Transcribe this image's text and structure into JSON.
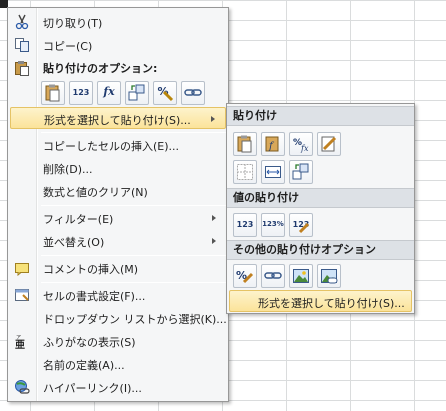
{
  "main_menu": {
    "cut": "切り取り(T)",
    "copy": "コピー(C)",
    "paste_options_header": "貼り付けのオプション:",
    "paste_special": "形式を選択して貼り付け(S)...",
    "insert_copied_cells": "コピーしたセルの挿入(E)...",
    "delete": "削除(D)...",
    "clear_contents": "数式と値のクリア(N)",
    "filter": "フィルター(E)",
    "sort": "並べ替え(O)",
    "insert_comment": "コメントの挿入(M)",
    "format_cells": "セルの書式設定(F)...",
    "pick_from_list": "ドロップダウン リストから選択(K)...",
    "show_furigana": "ふりがなの表示(S)",
    "define_name": "名前の定義(A)...",
    "hyperlink": "ハイパーリンク(I)..."
  },
  "paste_option_buttons": [
    {
      "icon": "paste-icon",
      "text": ""
    },
    {
      "icon": "paste-values-icon",
      "text": "123"
    },
    {
      "icon": "paste-formulas-icon",
      "text": "fx"
    },
    {
      "icon": "transpose-icon",
      "text": ""
    },
    {
      "icon": "paste-formatting-icon",
      "text": "%"
    },
    {
      "icon": "paste-link-icon",
      "text": ""
    }
  ],
  "submenu": {
    "paste_header": "貼り付け",
    "paste_values_header": "値の貼り付け",
    "other_paste_header": "その他の貼り付けオプション",
    "paste_special_item": "形式を選択して貼り付け(S)...",
    "paste_buttons": [
      "paste-icon",
      "paste-formulas-icon",
      "paste-formulas-number-format-icon",
      "keep-source-formatting-icon",
      "no-borders-icon",
      "keep-column-widths-icon",
      "transpose-icon"
    ],
    "values_buttons": [
      {
        "icon": "values-icon",
        "text": "123"
      },
      {
        "icon": "values-number-format-icon",
        "text": "123%"
      },
      {
        "icon": "values-source-formatting-icon",
        "text": "123"
      }
    ],
    "other_buttons": [
      "formatting-icon",
      "paste-link-icon",
      "picture-icon",
      "linked-picture-icon"
    ]
  }
}
